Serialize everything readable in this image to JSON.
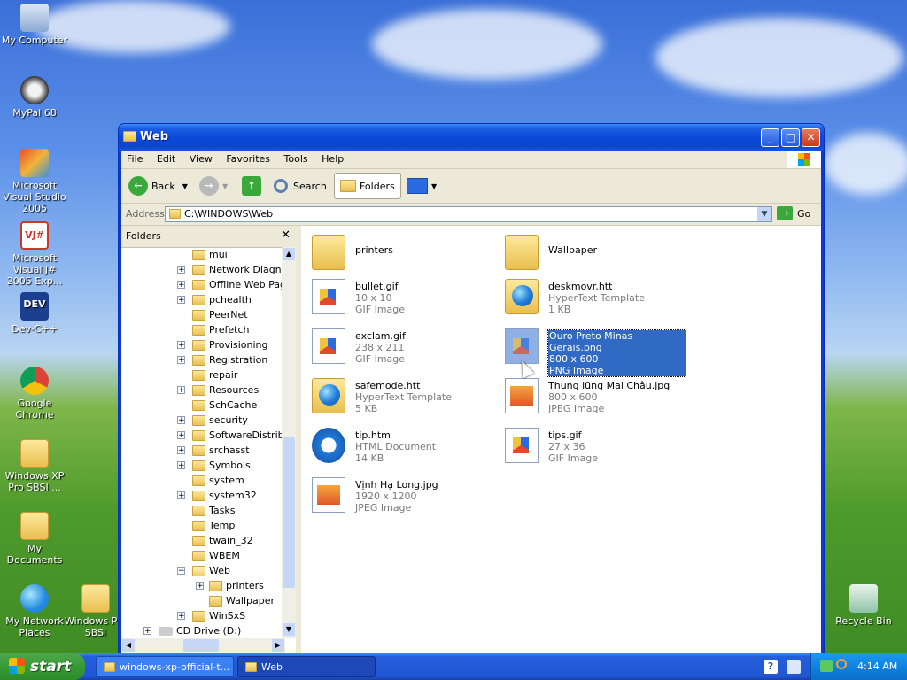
{
  "desktop": {
    "icons": [
      {
        "label": "My Computer"
      },
      {
        "label": "MyPal 68"
      },
      {
        "label": "Microsoft Visual Studio 2005"
      },
      {
        "label": "Microsoft Visual J# 2005 Exp..."
      },
      {
        "label": "Dev-C++"
      },
      {
        "label": "Google Chrome"
      },
      {
        "label": "Windows XP Pro SBSI ..."
      },
      {
        "label": "My Documents"
      },
      {
        "label": "My Network Places"
      },
      {
        "label": "Windows Pro SBSI"
      },
      {
        "label": "Recycle Bin"
      }
    ]
  },
  "window": {
    "title": "Web",
    "menu": [
      "File",
      "Edit",
      "View",
      "Favorites",
      "Tools",
      "Help"
    ],
    "toolbar": {
      "back": "Back",
      "search": "Search",
      "folders": "Folders"
    },
    "address": {
      "label": "Address",
      "value": "C:\\WINDOWS\\Web",
      "go": "Go"
    },
    "folders_pane": {
      "title": "Folders",
      "items": [
        "mui",
        "Network Diagnost",
        "Offline Web Page",
        "pchealth",
        "PeerNet",
        "Prefetch",
        "Provisioning",
        "Registration",
        "repair",
        "Resources",
        "SchCache",
        "security",
        "SoftwareDistribut",
        "srchasst",
        "Symbols",
        "system",
        "system32",
        "Tasks",
        "Temp",
        "twain_32",
        "WBEM",
        "Web",
        "printers",
        "Wallpaper",
        "WinSxS",
        "CD Drive (D:)"
      ]
    },
    "files": [
      {
        "name": "printers",
        "l2": "",
        "l3": ""
      },
      {
        "name": "Wallpaper",
        "l2": "",
        "l3": ""
      },
      {
        "name": "bullet.gif",
        "l2": "10 x 10",
        "l3": "GIF Image"
      },
      {
        "name": "deskmovr.htt",
        "l2": "HyperText Template",
        "l3": "1 KB"
      },
      {
        "name": "exclam.gif",
        "l2": "238 x 211",
        "l3": "GIF Image"
      },
      {
        "name": "Ouro Preto Minas Gerais.png",
        "l2": "800 x 600",
        "l3": "PNG Image"
      },
      {
        "name": "safemode.htt",
        "l2": "HyperText Template",
        "l3": "5 KB"
      },
      {
        "name": "Thung lũng Mai Châu.jpg",
        "l2": "800 x 600",
        "l3": "JPEG Image"
      },
      {
        "name": "tip.htm",
        "l2": "HTML Document",
        "l3": "14 KB"
      },
      {
        "name": "tips.gif",
        "l2": "27 x 36",
        "l3": "GIF Image"
      },
      {
        "name": "Vịnh Hạ Long.jpg",
        "l2": "1920 x 1200",
        "l3": "JPEG Image"
      }
    ]
  },
  "taskbar": {
    "start": "start",
    "tasks": [
      "windows-xp-official-t...",
      "Web"
    ],
    "clock": "4:14 AM"
  }
}
